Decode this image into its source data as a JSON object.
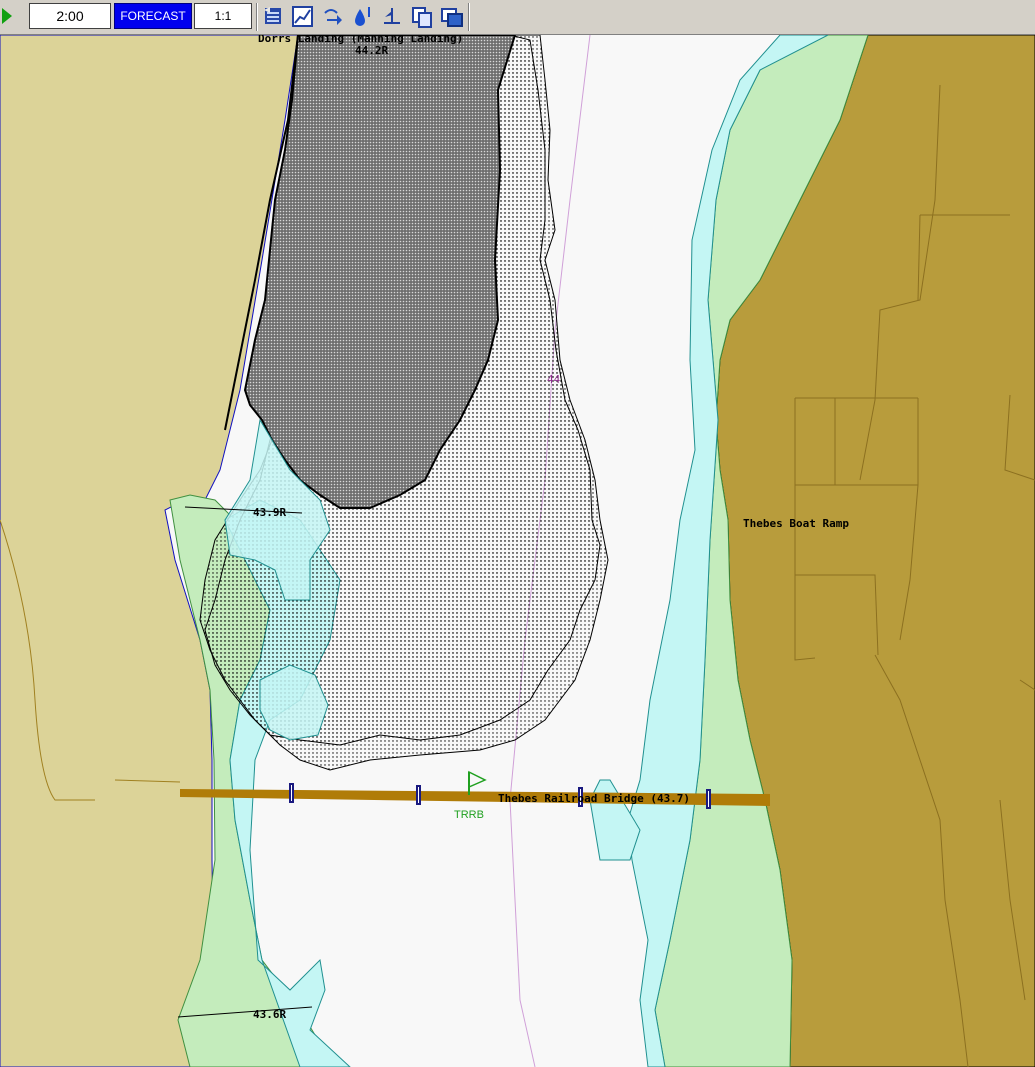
{
  "toolbar": {
    "time_value": "2:00",
    "mode_label": "FORECAST",
    "scale_label": "1:1",
    "icons": [
      "play-icon",
      "swap-layers-icon",
      "chart-view-icon",
      "flow-arrow-icon",
      "water-drop-icon",
      "wind-vane-icon",
      "copy-pages-icon",
      "windows-icon"
    ]
  },
  "map": {
    "labels": {
      "top_landing": "Dorrs Landing (Manning Landing)",
      "top_gauge": "44.2R",
      "contour_44": "44",
      "gauge_left_mid": "43.9R",
      "boat_ramp": "Thebes Boat Ramp",
      "bridge": "Thebes Railroad Bridge (43.7)",
      "flag_code": "TRRB",
      "gauge_bottom": "43.6R"
    },
    "colors": {
      "left_land": "#dcd398",
      "right_land": "#b89c3c",
      "water": "#f8f8f8",
      "shallow": "#c4f6f4",
      "vegetation": "#c4ecbc",
      "bridge": "#b07c08",
      "flag": "#20a020"
    }
  }
}
